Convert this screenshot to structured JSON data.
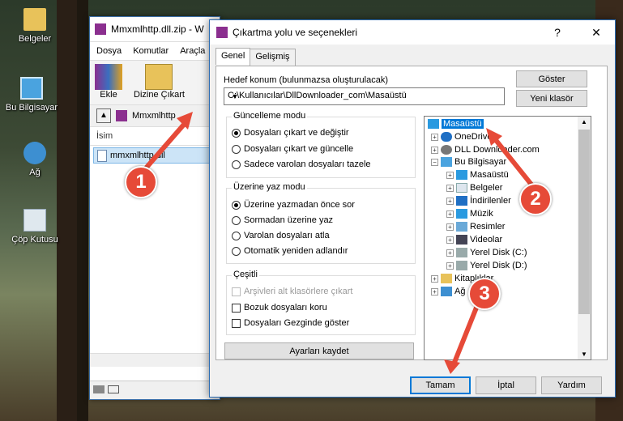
{
  "desktop": {
    "icons": [
      {
        "label": "Belgeler"
      },
      {
        "label": "Bu Bilgisayar"
      },
      {
        "label": "Ağ"
      },
      {
        "label": "Çöp Kutusu"
      }
    ]
  },
  "bg_window": {
    "title": "Mmxmlhttp.dll.zip - W",
    "menu": [
      "Dosya",
      "Komutlar",
      "Araçla"
    ],
    "toolbar": {
      "add": "Ekle",
      "extract": "Dizine Çıkart"
    },
    "address": "Mmxmlhttp",
    "column_name": "İsim",
    "file": "mmxmlhttp.dll"
  },
  "dialog": {
    "title": "Çıkartma yolu ve seçenekleri",
    "help": "?",
    "close": "✕",
    "tabs": [
      "Genel",
      "Gelişmiş"
    ],
    "target_label": "Hedef konum (bulunmazsa oluşturulacak)",
    "target_path": "C:\\Kullanıcılar\\DllDownloader_com\\Masaüstü",
    "show_button": "Göster",
    "new_folder_button": "Yeni klasör",
    "update_mode": {
      "title": "Güncelleme modu",
      "options": [
        "Dosyaları çıkart ve değiştir",
        "Dosyaları çıkart ve güncelle",
        "Sadece varolan dosyaları tazele"
      ],
      "selected": 0
    },
    "overwrite_mode": {
      "title": "Üzerine yaz modu",
      "options": [
        "Üzerine yazmadan önce sor",
        "Sormadan üzerine yaz",
        "Varolan dosyaları atla",
        "Otomatik yeniden adlandır"
      ],
      "selected": 0
    },
    "misc": {
      "title": "Çeşitli",
      "options": [
        {
          "label": "Arşivleri alt klasörlere çıkart",
          "checked": false,
          "disabled": true
        },
        {
          "label": "Bozuk dosyaları koru",
          "checked": false,
          "disabled": false
        },
        {
          "label": "Dosyaları Gezginde göster",
          "checked": false,
          "disabled": false
        }
      ]
    },
    "save_settings": "Ayarları kaydet",
    "tree": [
      {
        "label": "Masaüstü",
        "selected": true
      },
      {
        "label": "OneDrive"
      },
      {
        "label": "DLL Downloader.com"
      },
      {
        "label": "Bu Bilgisayar"
      },
      {
        "label": "Masaüstü"
      },
      {
        "label": "Belgeler"
      },
      {
        "label": "İndirilenler"
      },
      {
        "label": "Müzik"
      },
      {
        "label": "Resimler"
      },
      {
        "label": "Videolar"
      },
      {
        "label": "Yerel Disk (C:)"
      },
      {
        "label": "Yerel Disk (D:)"
      },
      {
        "label": "Kitaplıklar"
      },
      {
        "label": "Ağ"
      }
    ],
    "ok": "Tamam",
    "cancel": "İptal",
    "help_button": "Yardım"
  },
  "annotations": {
    "one": "1",
    "two": "2",
    "three": "3",
    "color": "#e64a38"
  }
}
